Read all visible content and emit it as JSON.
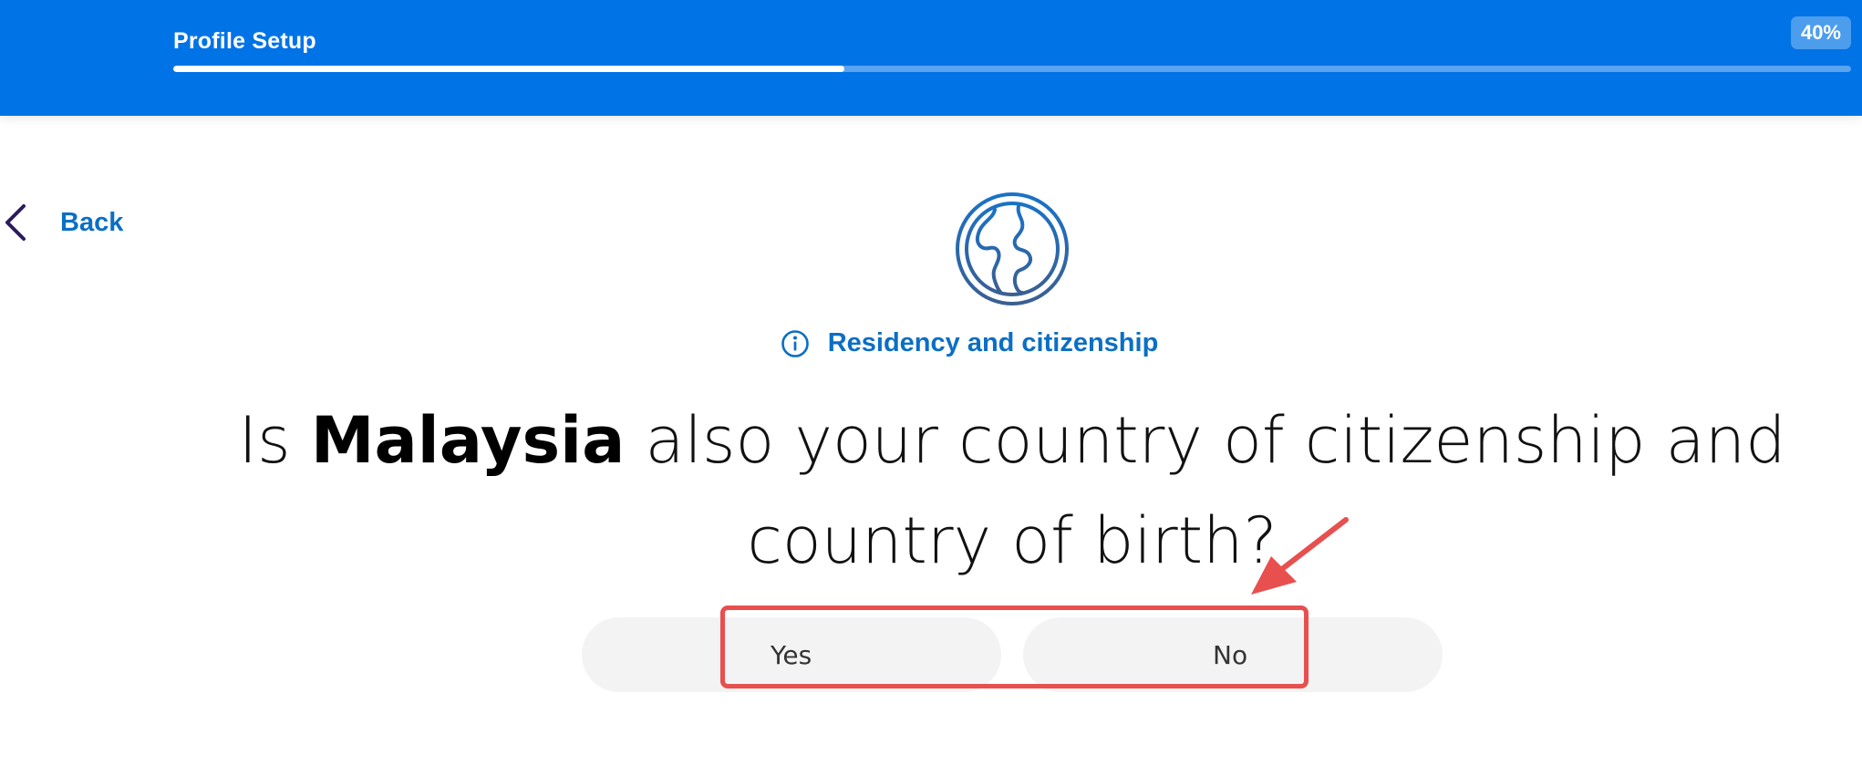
{
  "header": {
    "title": "Profile Setup",
    "progress_text": "40%",
    "progress_value": 0.4
  },
  "nav": {
    "back_label": "Back",
    "back_icon": "chevron-left-icon"
  },
  "section": {
    "icon": "globe-icon",
    "info_icon": "info-icon",
    "label": "Residency and citizenship"
  },
  "question": {
    "prefix": "Is ",
    "country": "Malaysia",
    "suffix": " also your country of citizenship and country of birth?"
  },
  "answers": {
    "yes_label": "Yes",
    "no_label": "No"
  },
  "colors": {
    "header_bg": "#0073e6",
    "accent_text": "#0b6fc4",
    "annotation": "#e84f4f",
    "button_bg": "#f3f3f3"
  }
}
